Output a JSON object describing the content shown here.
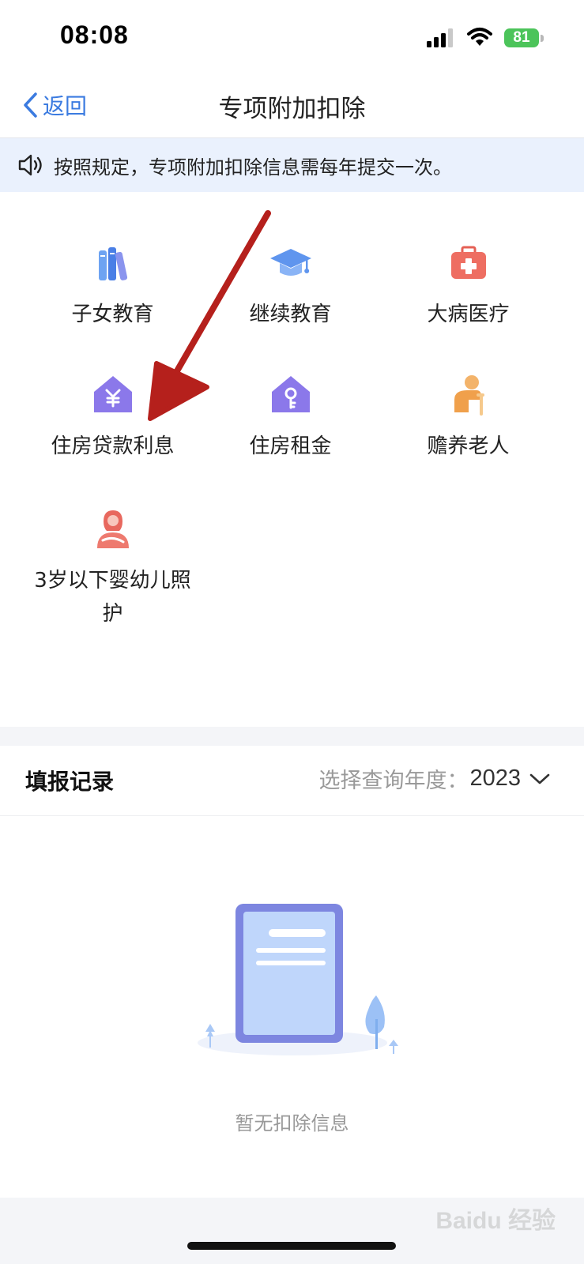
{
  "status_bar": {
    "time": "08:08",
    "battery": "81"
  },
  "nav": {
    "back_label": "返回",
    "title": "专项附加扣除"
  },
  "notice": {
    "text": "按照规定，专项附加扣除信息需每年提交一次。",
    "icon": "speaker-icon"
  },
  "categories": [
    {
      "label": "子女教育",
      "icon": "books-icon"
    },
    {
      "label": "继续教育",
      "icon": "graduation-cap-icon"
    },
    {
      "label": "大病医疗",
      "icon": "medical-kit-icon"
    },
    {
      "label": "住房贷款利息",
      "icon": "house-yen-icon"
    },
    {
      "label": "住房租金",
      "icon": "house-key-icon"
    },
    {
      "label": "赡养老人",
      "icon": "elderly-person-icon"
    },
    {
      "label": "3岁以下婴幼儿照护",
      "icon": "mother-baby-icon"
    }
  ],
  "records": {
    "title": "填报记录",
    "year_label": "选择查询年度：",
    "year_value": "2023",
    "empty_text": "暂无扣除信息"
  },
  "watermark": "Baidu 经验",
  "colors": {
    "accent": "#3b7be0",
    "notice_bg": "#eaf1fd",
    "annotation_arrow": "#b5201c"
  }
}
